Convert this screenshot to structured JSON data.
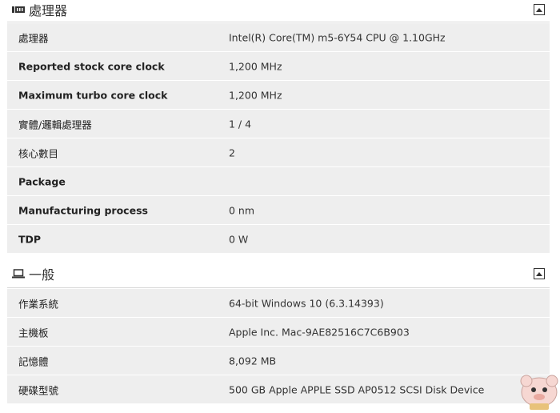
{
  "cpu": {
    "title": "處理器",
    "icon": "cpu-icon",
    "rows": [
      {
        "label": "處理器",
        "value": "Intel(R) Core(TM) m5-6Y54 CPU @ 1.10GHz",
        "bold": false
      },
      {
        "label": "Reported stock core clock",
        "value": "1,200 MHz",
        "bold": true
      },
      {
        "label": "Maximum turbo core clock",
        "value": "1,200 MHz",
        "bold": true
      },
      {
        "label": "實體/邏輯處理器",
        "value": "1 / 4",
        "bold": false
      },
      {
        "label": "核心數目",
        "value": "2",
        "bold": false
      },
      {
        "label": "Package",
        "value": "",
        "bold": true
      },
      {
        "label": "Manufacturing process",
        "value": "0 nm",
        "bold": true
      },
      {
        "label": "TDP",
        "value": "0 W",
        "bold": true
      }
    ]
  },
  "general": {
    "title": "一般",
    "icon": "laptop-icon",
    "rows": [
      {
        "label": "作業系統",
        "value": "64-bit Windows 10 (6.3.14393)",
        "bold": false
      },
      {
        "label": "主機板",
        "value": "Apple Inc. Mac-9AE82516C7C6B903",
        "bold": false
      },
      {
        "label": "記憶體",
        "value": "8,092 MB",
        "bold": false
      },
      {
        "label": "硬碟型號",
        "value": "500 GB Apple APPLE SSD AP0512 SCSI Disk Device",
        "bold": false
      }
    ]
  },
  "colors": {
    "row_bg": "#eeeeee",
    "text": "#333333"
  }
}
